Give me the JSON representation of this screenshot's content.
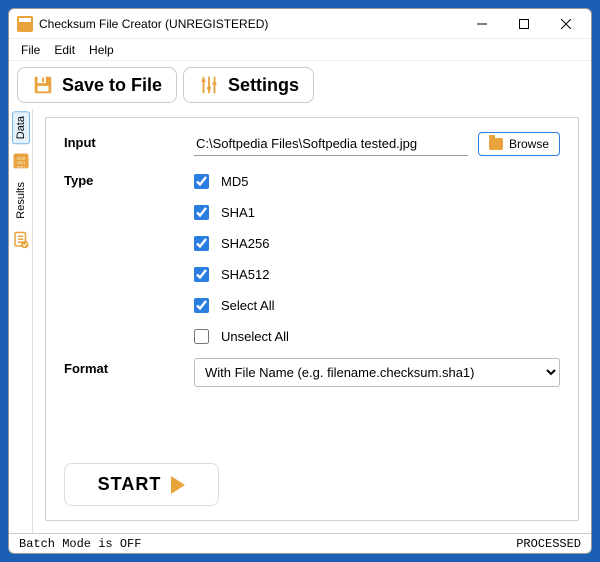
{
  "window": {
    "title": "Checksum File Creator (UNREGISTERED)"
  },
  "menu": {
    "file": "File",
    "edit": "Edit",
    "help": "Help"
  },
  "toolbar": {
    "save": "Save to File",
    "settings": "Settings"
  },
  "sidebar": {
    "tabs": [
      {
        "label": "Data"
      },
      {
        "label": "Results"
      }
    ]
  },
  "form": {
    "input_label": "Input",
    "input_value": "C:\\Softpedia Files\\Softpedia tested.jpg",
    "browse_label": "Browse",
    "type_label": "Type",
    "checks": [
      {
        "label": "MD5",
        "checked": true
      },
      {
        "label": "SHA1",
        "checked": true
      },
      {
        "label": "SHA256",
        "checked": true
      },
      {
        "label": "SHA512",
        "checked": true
      },
      {
        "label": "Select All",
        "checked": true
      },
      {
        "label": "Unselect All",
        "checked": false
      }
    ],
    "format_label": "Format",
    "format_value": "With File Name (e.g. filename.checksum.sha1)",
    "start_label": "START"
  },
  "status": {
    "left": "Batch Mode is OFF",
    "right": "PROCESSED"
  }
}
